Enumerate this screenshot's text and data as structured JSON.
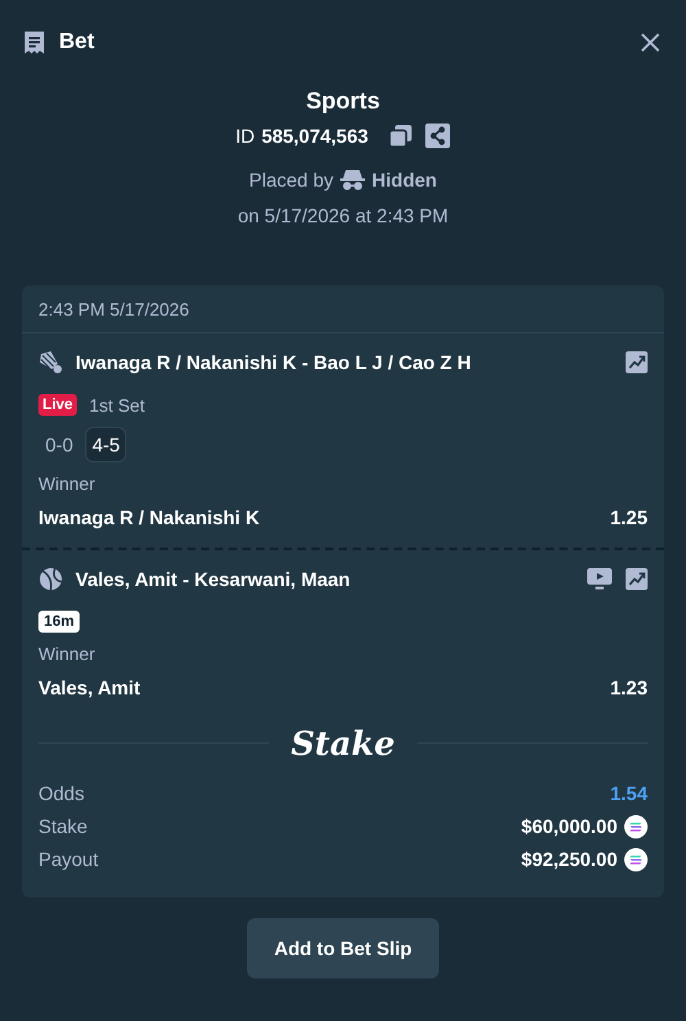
{
  "header": {
    "title": "Bet"
  },
  "bet": {
    "category": "Sports",
    "id_label": "ID",
    "id": "585,074,563",
    "placed_by_label": "Placed by",
    "placed_by": "Hidden",
    "placed_on": "on 5/17/2026 at 2:43 PM"
  },
  "card": {
    "timestamp": "2:43 PM 5/17/2026",
    "legs": [
      {
        "kind": "badminton",
        "title": "Iwanaga R / Nakanishi K - Bao L J / Cao Z H",
        "has_stream": false,
        "status": {
          "kind": "live",
          "badge": "Live",
          "period": "1st Set",
          "scores": [
            {
              "text": "0-0",
              "current": false
            },
            {
              "text": "4-5",
              "current": true
            }
          ]
        },
        "market": "Winner",
        "selection": "Iwanaga R / Nakanishi K",
        "odds": "1.25"
      },
      {
        "kind": "tennis",
        "title": "Vales, Amit - Kesarwani, Maan",
        "has_stream": true,
        "status": {
          "kind": "upcoming",
          "badge": "16m"
        },
        "market": "Winner",
        "selection": "Vales, Amit",
        "odds": "1.23"
      }
    ],
    "brand": "Stake",
    "summary": [
      {
        "label": "Odds",
        "value": "1.54",
        "kind": "odds"
      },
      {
        "label": "Stake",
        "value": "$60,000.00",
        "kind": "amount"
      },
      {
        "label": "Payout",
        "value": "$92,250.00",
        "kind": "amount"
      }
    ]
  },
  "button": "Add to Bet Slip"
}
